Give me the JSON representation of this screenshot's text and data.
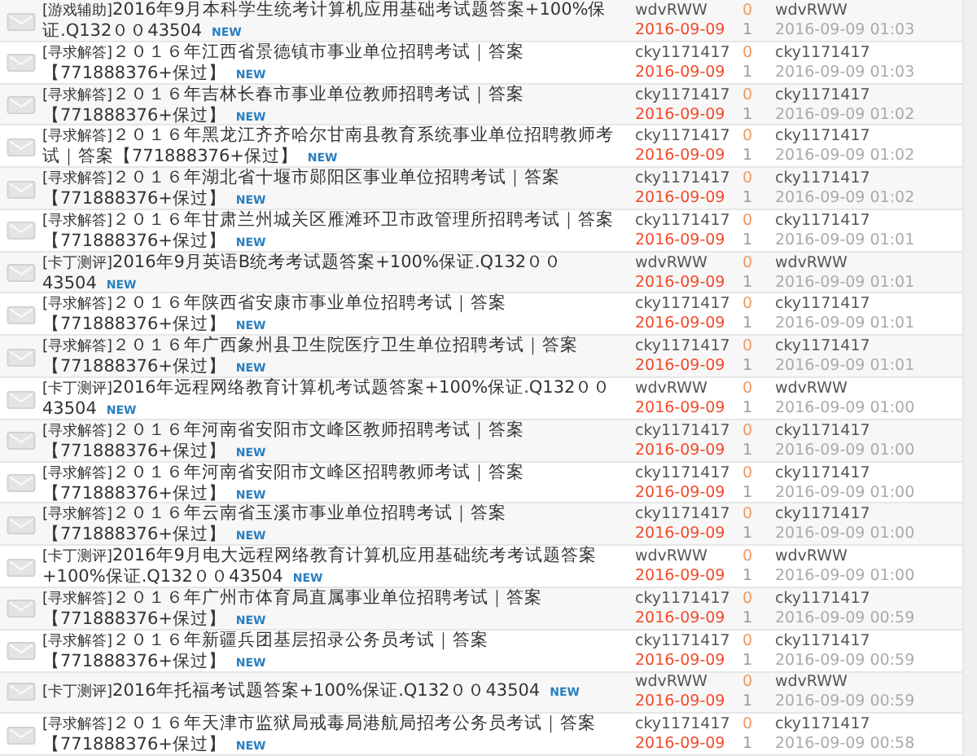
{
  "threads": [
    {
      "category": "[游戏辅助]",
      "title": "2016年9月本科学生统考计算机应用基础考试题答案+100%保证.Q132００43504",
      "badge": "NEW",
      "author": "wdvRWW",
      "date": "2016-09-09",
      "replies": "0",
      "views": "1",
      "last_poster": "wdvRWW",
      "last_time": "2016-09-09 01:03"
    },
    {
      "category": "[寻求解答]",
      "title": "２０１６年江西省景德镇市事业单位招聘考试｜答案【771888376+保过】",
      "badge": "NEW",
      "author": "cky1171417",
      "date": "2016-09-09",
      "replies": "0",
      "views": "1",
      "last_poster": "cky1171417",
      "last_time": "2016-09-09 01:03"
    },
    {
      "category": "[寻求解答]",
      "title": "２０１６年吉林长春市事业单位教师招聘考试｜答案【771888376+保过】",
      "badge": "NEW",
      "author": "cky1171417",
      "date": "2016-09-09",
      "replies": "0",
      "views": "1",
      "last_poster": "cky1171417",
      "last_time": "2016-09-09 01:02"
    },
    {
      "category": "[寻求解答]",
      "title": "２０１６年黑龙江齐齐哈尔甘南县教育系统事业单位招聘教师考试｜答案【771888376+保过】",
      "badge": "NEW",
      "author": "cky1171417",
      "date": "2016-09-09",
      "replies": "0",
      "views": "1",
      "last_poster": "cky1171417",
      "last_time": "2016-09-09 01:02"
    },
    {
      "category": "[寻求解答]",
      "title": "２０１６年湖北省十堰市郧阳区事业单位招聘考试｜答案【771888376+保过】",
      "badge": "NEW",
      "author": "cky1171417",
      "date": "2016-09-09",
      "replies": "0",
      "views": "1",
      "last_poster": "cky1171417",
      "last_time": "2016-09-09 01:02"
    },
    {
      "category": "[寻求解答]",
      "title": "２０１６年甘肃兰州城关区雁滩环卫市政管理所招聘考试｜答案【771888376+保过】",
      "badge": "NEW",
      "author": "cky1171417",
      "date": "2016-09-09",
      "replies": "0",
      "views": "1",
      "last_poster": "cky1171417",
      "last_time": "2016-09-09 01:01"
    },
    {
      "category": "[卡丁测评]",
      "title": "2016年9月英语B统考考试题答案+100%保证.Q132００43504",
      "badge": "NEW",
      "author": "wdvRWW",
      "date": "2016-09-09",
      "replies": "0",
      "views": "1",
      "last_poster": "wdvRWW",
      "last_time": "2016-09-09 01:01"
    },
    {
      "category": "[寻求解答]",
      "title": "２０１６年陕西省安康市事业单位招聘考试｜答案【771888376+保过】",
      "badge": "NEW",
      "author": "cky1171417",
      "date": "2016-09-09",
      "replies": "0",
      "views": "1",
      "last_poster": "cky1171417",
      "last_time": "2016-09-09 01:01"
    },
    {
      "category": "[寻求解答]",
      "title": "２０１６年广西象州县卫生院医疗卫生单位招聘考试｜答案【771888376+保过】",
      "badge": "NEW",
      "author": "cky1171417",
      "date": "2016-09-09",
      "replies": "0",
      "views": "1",
      "last_poster": "cky1171417",
      "last_time": "2016-09-09 01:01"
    },
    {
      "category": "[卡丁测评]",
      "title": "2016年远程网络教育计算机考试题答案+100%保证.Q132００43504",
      "badge": "NEW",
      "author": "wdvRWW",
      "date": "2016-09-09",
      "replies": "0",
      "views": "1",
      "last_poster": "wdvRWW",
      "last_time": "2016-09-09 01:00"
    },
    {
      "category": "[寻求解答]",
      "title": "２０１６年河南省安阳市文峰区教师招聘考试｜答案【771888376+保过】",
      "badge": "NEW",
      "author": "cky1171417",
      "date": "2016-09-09",
      "replies": "0",
      "views": "1",
      "last_poster": "cky1171417",
      "last_time": "2016-09-09 01:00"
    },
    {
      "category": "[寻求解答]",
      "title": "２０１６年河南省安阳市文峰区招聘教师考试｜答案【771888376+保过】",
      "badge": "NEW",
      "author": "cky1171417",
      "date": "2016-09-09",
      "replies": "0",
      "views": "1",
      "last_poster": "cky1171417",
      "last_time": "2016-09-09 01:00"
    },
    {
      "category": "[寻求解答]",
      "title": "２０１６年云南省玉溪市事业单位招聘考试｜答案【771888376+保过】",
      "badge": "NEW",
      "author": "cky1171417",
      "date": "2016-09-09",
      "replies": "0",
      "views": "1",
      "last_poster": "cky1171417",
      "last_time": "2016-09-09 01:00"
    },
    {
      "category": "[卡丁测评]",
      "title": "2016年9月电大远程网络教育计算机应用基础统考考试题答案+100%保证.Q132００43504",
      "badge": "NEW",
      "author": "wdvRWW",
      "date": "2016-09-09",
      "replies": "0",
      "views": "1",
      "last_poster": "wdvRWW",
      "last_time": "2016-09-09 01:00"
    },
    {
      "category": "[寻求解答]",
      "title": "２０１６年广州市体育局直属事业单位招聘考试｜答案【771888376+保过】",
      "badge": "NEW",
      "author": "cky1171417",
      "date": "2016-09-09",
      "replies": "0",
      "views": "1",
      "last_poster": "cky1171417",
      "last_time": "2016-09-09 00:59"
    },
    {
      "category": "[寻求解答]",
      "title": "２０１６年新疆兵团基层招录公务员考试｜答案【771888376+保过】",
      "badge": "NEW",
      "author": "cky1171417",
      "date": "2016-09-09",
      "replies": "0",
      "views": "1",
      "last_poster": "cky1171417",
      "last_time": "2016-09-09 00:59"
    },
    {
      "category": "[卡丁测评]",
      "title": "2016年托福考试题答案+100%保证.Q132００43504",
      "badge": "NEW",
      "author": "wdvRWW",
      "date": "2016-09-09",
      "replies": "0",
      "views": "1",
      "last_poster": "wdvRWW",
      "last_time": "2016-09-09 00:59"
    },
    {
      "category": "[寻求解答]",
      "title": "２０１６年天津市监狱局戒毒局港航局招考公务员考试｜答案【771888376+保过】",
      "badge": "NEW",
      "author": "cky1171417",
      "date": "2016-09-09",
      "replies": "0",
      "views": "1",
      "last_poster": "cky1171417",
      "last_time": "2016-09-09 00:58"
    }
  ]
}
